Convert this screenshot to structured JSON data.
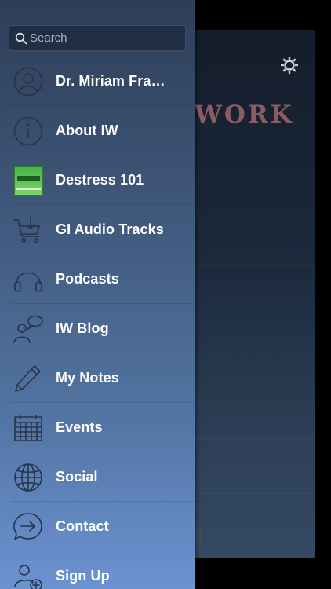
{
  "background": {
    "title": "WORK"
  },
  "search": {
    "placeholder": "Search",
    "value": ""
  },
  "menu": {
    "items": [
      {
        "label": "Dr. Miriam Fra…",
        "icon": "user-profile-icon"
      },
      {
        "label": "About IW",
        "icon": "info-icon"
      },
      {
        "label": "Destress 101",
        "icon": "destress-thumbnail"
      },
      {
        "label": "GI Audio Tracks",
        "icon": "cart-download-icon"
      },
      {
        "label": "Podcasts",
        "icon": "headphones-icon"
      },
      {
        "label": "IW Blog",
        "icon": "blog-person-speech-icon"
      },
      {
        "label": "My Notes",
        "icon": "pencil-icon"
      },
      {
        "label": "Events",
        "icon": "calendar-icon"
      },
      {
        "label": "Social",
        "icon": "globe-icon"
      },
      {
        "label": "Contact",
        "icon": "chat-arrow-icon"
      },
      {
        "label": "Sign Up",
        "icon": "add-user-icon"
      }
    ]
  },
  "colors": {
    "drawer_top": "#2d3e57",
    "drawer_bottom": "#6c93d2",
    "title_color": "#8c5b64",
    "label_color": "#ffffff"
  }
}
